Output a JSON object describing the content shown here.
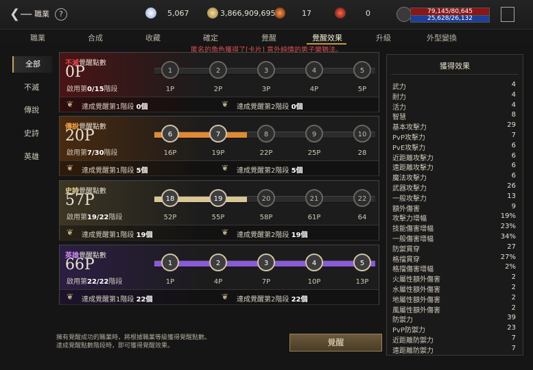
{
  "topbar": {
    "title": "職業",
    "help": "?",
    "diamonds": "5,067",
    "gold": "3,866,909,695",
    "token1": "17",
    "token2": "0",
    "hp": "79,145/80,645",
    "mp": "25,628/26,132"
  },
  "tabs": [
    "職業",
    "合成",
    "收藏",
    "確定",
    "覺醒",
    "覺醒效果",
    "升級",
    "外型變換"
  ],
  "notice": "匿名的角色獲得了[卡片] 意外純情的男子樂猶法。",
  "sidebar": [
    "全部",
    "不滅",
    "傳說",
    "史詩",
    "英雄"
  ],
  "cards": [
    {
      "tag": "不滅",
      "title": "覺醒點數",
      "points": "0P",
      "step_prefix": "啟用第",
      "step_val": "0/15",
      "step_suffix": "階段",
      "nodes": [
        "1",
        "2",
        "3",
        "4",
        "5"
      ],
      "marks": [
        "1P",
        "2P",
        "3P",
        "4P",
        "5P"
      ],
      "foot1": "達成覺醒第1階段",
      "foot1_count": "0個",
      "foot2": "達成覺醒第2階段",
      "foot2_count": "0個",
      "fill": 0.0,
      "nodes_on": 0
    },
    {
      "tag": "傳說",
      "title": "覺醒點數",
      "points": "20P",
      "step_prefix": "啟用第",
      "step_val": "7/30",
      "step_suffix": "階段",
      "nodes": [
        "6",
        "7",
        "8",
        "9",
        "10"
      ],
      "marks": [
        "16P",
        "19P",
        "22P",
        "25P",
        "28"
      ],
      "foot1": "達成覺醒第1階段",
      "foot1_count": "5個",
      "foot2": "達成覺醒第2階段",
      "foot2_count": "5個",
      "fill": 0.42,
      "nodes_on": 2
    },
    {
      "tag": "史詩",
      "title": "覺醒點數",
      "points": "57P",
      "step_prefix": "啟用第",
      "step_val": "19/22",
      "step_suffix": "階段",
      "nodes": [
        "18",
        "19",
        "20",
        "21",
        "22"
      ],
      "marks": [
        "52P",
        "55P",
        "58P",
        "61P",
        "64"
      ],
      "foot1": "達成覺醒第1階段",
      "foot1_count": "19個",
      "foot2": "達成覺醒第2階段",
      "foot2_count": "19個",
      "fill": 0.42,
      "nodes_on": 2
    },
    {
      "tag": "英雄",
      "title": "覺醒點數",
      "points": "66P",
      "step_prefix": "啟用第",
      "step_val": "22/22",
      "step_suffix": "階段",
      "nodes": [
        "1",
        "2",
        "3",
        "4",
        "5"
      ],
      "marks": [
        "1P",
        "4P",
        "7P",
        "10P",
        "13P"
      ],
      "foot1": "達成覺醒第1階段",
      "foot1_count": "22個",
      "foot2": "達成覺醒第2階段",
      "foot2_count": "22個",
      "fill": 1.0,
      "nodes_on": 5
    }
  ],
  "panel": {
    "title": "獲得效果",
    "stats": [
      [
        "武力",
        "4"
      ],
      [
        "耐力",
        "4"
      ],
      [
        "活力",
        "4"
      ],
      [
        "智慧",
        "8"
      ],
      [
        "基本攻擊力",
        "29"
      ],
      [
        "PvP攻擊力",
        "7"
      ],
      [
        "PvE攻擊力",
        "6"
      ],
      [
        "近距離攻擊力",
        "6"
      ],
      [
        "遠距離攻擊力",
        "6"
      ],
      [
        "魔法攻擊力",
        "6"
      ],
      [
        "武器攻擊力",
        "26"
      ],
      [
        "一般攻擊力",
        "13"
      ],
      [
        "額外傷害",
        "9"
      ],
      [
        "攻擊力增幅",
        "19%"
      ],
      [
        "技能傷害增幅",
        "23%"
      ],
      [
        "一般傷害增幅",
        "34%"
      ],
      [
        "防禦貫穿",
        "27"
      ],
      [
        "格擋貫穿",
        "27%"
      ],
      [
        "格擋傷害增幅",
        "2%"
      ],
      [
        "火屬性額外傷害",
        "2"
      ],
      [
        "水屬性額外傷害",
        "2"
      ],
      [
        "地屬性額外傷害",
        "2"
      ],
      [
        "風屬性額外傷害",
        "2"
      ],
      [
        "防禦力",
        "39"
      ],
      [
        "PvP防禦力",
        "23"
      ],
      [
        "近距離防禦力",
        "7"
      ],
      [
        "遠距離防禦力",
        "7"
      ]
    ]
  },
  "hint": [
    "擁有覺醒成功的職業時，將根據職業等級獲得覺醒點數。",
    "達成覺醒點數階段時，即可獲得覺醒效果。"
  ],
  "awaken_button": "覺醒",
  "colors": {
    "card_bg": [
      "#4a1416",
      "#4a2a10",
      "#3d3624",
      "#2c1e44"
    ],
    "tag": [
      "#e0454a",
      "#f2a048",
      "#e8d49a",
      "#c98af0"
    ],
    "fill": [
      "#a85a1c",
      "#e08a34",
      "#d8c694",
      "#8a5ad8"
    ]
  }
}
